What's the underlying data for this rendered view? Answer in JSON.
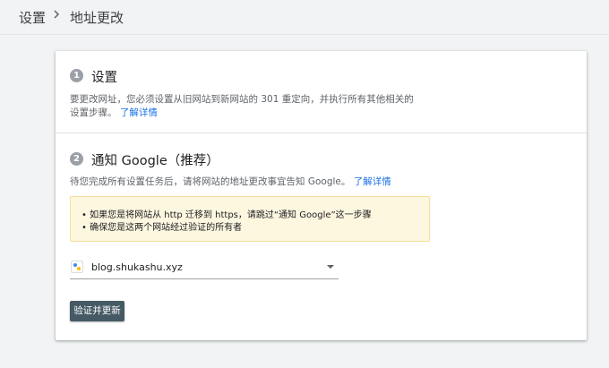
{
  "breadcrumb": {
    "parent": "设置",
    "current": "地址更改"
  },
  "step1": {
    "number": "1",
    "title": "设置",
    "description_line1": "要更改网址，您必须设置从旧网站到新网站的 301 重定向，并执行所有其他相关的",
    "description_line2": "设置步骤。",
    "learn_more": "了解详情"
  },
  "step2": {
    "number": "2",
    "title": "通知 Google（推荐）",
    "description": "待您完成所有设置任务后，请将网站的地址更改事宜告知 Google。",
    "learn_more": "了解详情",
    "notice": {
      "line1": "• 如果您是将网站从 http 迁移到 https，请跳过“通知 Google”这一步骤",
      "line2": "• 确保您是这两个网站经过验证的所有者"
    },
    "site_select": {
      "value": "blog.shukashu.xyz"
    },
    "verify_button": "验证并更新"
  }
}
